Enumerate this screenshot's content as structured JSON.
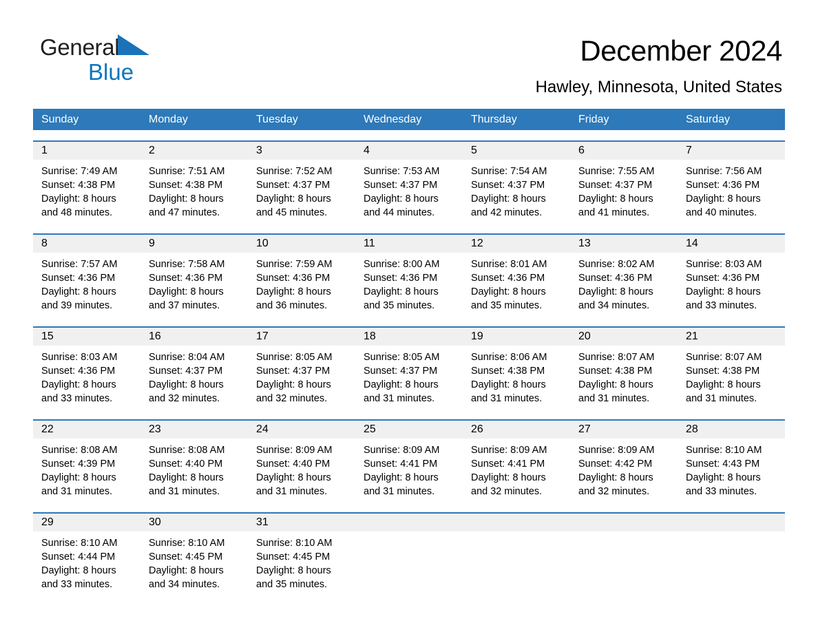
{
  "brand": {
    "name_part1": "General",
    "name_part2": "Blue",
    "accent_color": "#0e76bc",
    "triangle_icon": "brand-triangle-icon"
  },
  "header": {
    "title": "December 2024",
    "subtitle": "Hawley, Minnesota, United States"
  },
  "calendar": {
    "header_bg": "#2d79b9",
    "day_band_bg": "#f0f0f0",
    "weekdays": [
      "Sunday",
      "Monday",
      "Tuesday",
      "Wednesday",
      "Thursday",
      "Friday",
      "Saturday"
    ],
    "weeks": [
      [
        {
          "day": "1",
          "sunrise": "Sunrise: 7:49 AM",
          "sunset": "Sunset: 4:38 PM",
          "daylight_line1": "Daylight: 8 hours",
          "daylight_line2": "and 48 minutes."
        },
        {
          "day": "2",
          "sunrise": "Sunrise: 7:51 AM",
          "sunset": "Sunset: 4:38 PM",
          "daylight_line1": "Daylight: 8 hours",
          "daylight_line2": "and 47 minutes."
        },
        {
          "day": "3",
          "sunrise": "Sunrise: 7:52 AM",
          "sunset": "Sunset: 4:37 PM",
          "daylight_line1": "Daylight: 8 hours",
          "daylight_line2": "and 45 minutes."
        },
        {
          "day": "4",
          "sunrise": "Sunrise: 7:53 AM",
          "sunset": "Sunset: 4:37 PM",
          "daylight_line1": "Daylight: 8 hours",
          "daylight_line2": "and 44 minutes."
        },
        {
          "day": "5",
          "sunrise": "Sunrise: 7:54 AM",
          "sunset": "Sunset: 4:37 PM",
          "daylight_line1": "Daylight: 8 hours",
          "daylight_line2": "and 42 minutes."
        },
        {
          "day": "6",
          "sunrise": "Sunrise: 7:55 AM",
          "sunset": "Sunset: 4:37 PM",
          "daylight_line1": "Daylight: 8 hours",
          "daylight_line2": "and 41 minutes."
        },
        {
          "day": "7",
          "sunrise": "Sunrise: 7:56 AM",
          "sunset": "Sunset: 4:36 PM",
          "daylight_line1": "Daylight: 8 hours",
          "daylight_line2": "and 40 minutes."
        }
      ],
      [
        {
          "day": "8",
          "sunrise": "Sunrise: 7:57 AM",
          "sunset": "Sunset: 4:36 PM",
          "daylight_line1": "Daylight: 8 hours",
          "daylight_line2": "and 39 minutes."
        },
        {
          "day": "9",
          "sunrise": "Sunrise: 7:58 AM",
          "sunset": "Sunset: 4:36 PM",
          "daylight_line1": "Daylight: 8 hours",
          "daylight_line2": "and 37 minutes."
        },
        {
          "day": "10",
          "sunrise": "Sunrise: 7:59 AM",
          "sunset": "Sunset: 4:36 PM",
          "daylight_line1": "Daylight: 8 hours",
          "daylight_line2": "and 36 minutes."
        },
        {
          "day": "11",
          "sunrise": "Sunrise: 8:00 AM",
          "sunset": "Sunset: 4:36 PM",
          "daylight_line1": "Daylight: 8 hours",
          "daylight_line2": "and 35 minutes."
        },
        {
          "day": "12",
          "sunrise": "Sunrise: 8:01 AM",
          "sunset": "Sunset: 4:36 PM",
          "daylight_line1": "Daylight: 8 hours",
          "daylight_line2": "and 35 minutes."
        },
        {
          "day": "13",
          "sunrise": "Sunrise: 8:02 AM",
          "sunset": "Sunset: 4:36 PM",
          "daylight_line1": "Daylight: 8 hours",
          "daylight_line2": "and 34 minutes."
        },
        {
          "day": "14",
          "sunrise": "Sunrise: 8:03 AM",
          "sunset": "Sunset: 4:36 PM",
          "daylight_line1": "Daylight: 8 hours",
          "daylight_line2": "and 33 minutes."
        }
      ],
      [
        {
          "day": "15",
          "sunrise": "Sunrise: 8:03 AM",
          "sunset": "Sunset: 4:36 PM",
          "daylight_line1": "Daylight: 8 hours",
          "daylight_line2": "and 33 minutes."
        },
        {
          "day": "16",
          "sunrise": "Sunrise: 8:04 AM",
          "sunset": "Sunset: 4:37 PM",
          "daylight_line1": "Daylight: 8 hours",
          "daylight_line2": "and 32 minutes."
        },
        {
          "day": "17",
          "sunrise": "Sunrise: 8:05 AM",
          "sunset": "Sunset: 4:37 PM",
          "daylight_line1": "Daylight: 8 hours",
          "daylight_line2": "and 32 minutes."
        },
        {
          "day": "18",
          "sunrise": "Sunrise: 8:05 AM",
          "sunset": "Sunset: 4:37 PM",
          "daylight_line1": "Daylight: 8 hours",
          "daylight_line2": "and 31 minutes."
        },
        {
          "day": "19",
          "sunrise": "Sunrise: 8:06 AM",
          "sunset": "Sunset: 4:38 PM",
          "daylight_line1": "Daylight: 8 hours",
          "daylight_line2": "and 31 minutes."
        },
        {
          "day": "20",
          "sunrise": "Sunrise: 8:07 AM",
          "sunset": "Sunset: 4:38 PM",
          "daylight_line1": "Daylight: 8 hours",
          "daylight_line2": "and 31 minutes."
        },
        {
          "day": "21",
          "sunrise": "Sunrise: 8:07 AM",
          "sunset": "Sunset: 4:38 PM",
          "daylight_line1": "Daylight: 8 hours",
          "daylight_line2": "and 31 minutes."
        }
      ],
      [
        {
          "day": "22",
          "sunrise": "Sunrise: 8:08 AM",
          "sunset": "Sunset: 4:39 PM",
          "daylight_line1": "Daylight: 8 hours",
          "daylight_line2": "and 31 minutes."
        },
        {
          "day": "23",
          "sunrise": "Sunrise: 8:08 AM",
          "sunset": "Sunset: 4:40 PM",
          "daylight_line1": "Daylight: 8 hours",
          "daylight_line2": "and 31 minutes."
        },
        {
          "day": "24",
          "sunrise": "Sunrise: 8:09 AM",
          "sunset": "Sunset: 4:40 PM",
          "daylight_line1": "Daylight: 8 hours",
          "daylight_line2": "and 31 minutes."
        },
        {
          "day": "25",
          "sunrise": "Sunrise: 8:09 AM",
          "sunset": "Sunset: 4:41 PM",
          "daylight_line1": "Daylight: 8 hours",
          "daylight_line2": "and 31 minutes."
        },
        {
          "day": "26",
          "sunrise": "Sunrise: 8:09 AM",
          "sunset": "Sunset: 4:41 PM",
          "daylight_line1": "Daylight: 8 hours",
          "daylight_line2": "and 32 minutes."
        },
        {
          "day": "27",
          "sunrise": "Sunrise: 8:09 AM",
          "sunset": "Sunset: 4:42 PM",
          "daylight_line1": "Daylight: 8 hours",
          "daylight_line2": "and 32 minutes."
        },
        {
          "day": "28",
          "sunrise": "Sunrise: 8:10 AM",
          "sunset": "Sunset: 4:43 PM",
          "daylight_line1": "Daylight: 8 hours",
          "daylight_line2": "and 33 minutes."
        }
      ],
      [
        {
          "day": "29",
          "sunrise": "Sunrise: 8:10 AM",
          "sunset": "Sunset: 4:44 PM",
          "daylight_line1": "Daylight: 8 hours",
          "daylight_line2": "and 33 minutes."
        },
        {
          "day": "30",
          "sunrise": "Sunrise: 8:10 AM",
          "sunset": "Sunset: 4:45 PM",
          "daylight_line1": "Daylight: 8 hours",
          "daylight_line2": "and 34 minutes."
        },
        {
          "day": "31",
          "sunrise": "Sunrise: 8:10 AM",
          "sunset": "Sunset: 4:45 PM",
          "daylight_line1": "Daylight: 8 hours",
          "daylight_line2": "and 35 minutes."
        },
        {
          "day": "",
          "sunrise": "",
          "sunset": "",
          "daylight_line1": "",
          "daylight_line2": ""
        },
        {
          "day": "",
          "sunrise": "",
          "sunset": "",
          "daylight_line1": "",
          "daylight_line2": ""
        },
        {
          "day": "",
          "sunrise": "",
          "sunset": "",
          "daylight_line1": "",
          "daylight_line2": ""
        },
        {
          "day": "",
          "sunrise": "",
          "sunset": "",
          "daylight_line1": "",
          "daylight_line2": ""
        }
      ]
    ]
  }
}
